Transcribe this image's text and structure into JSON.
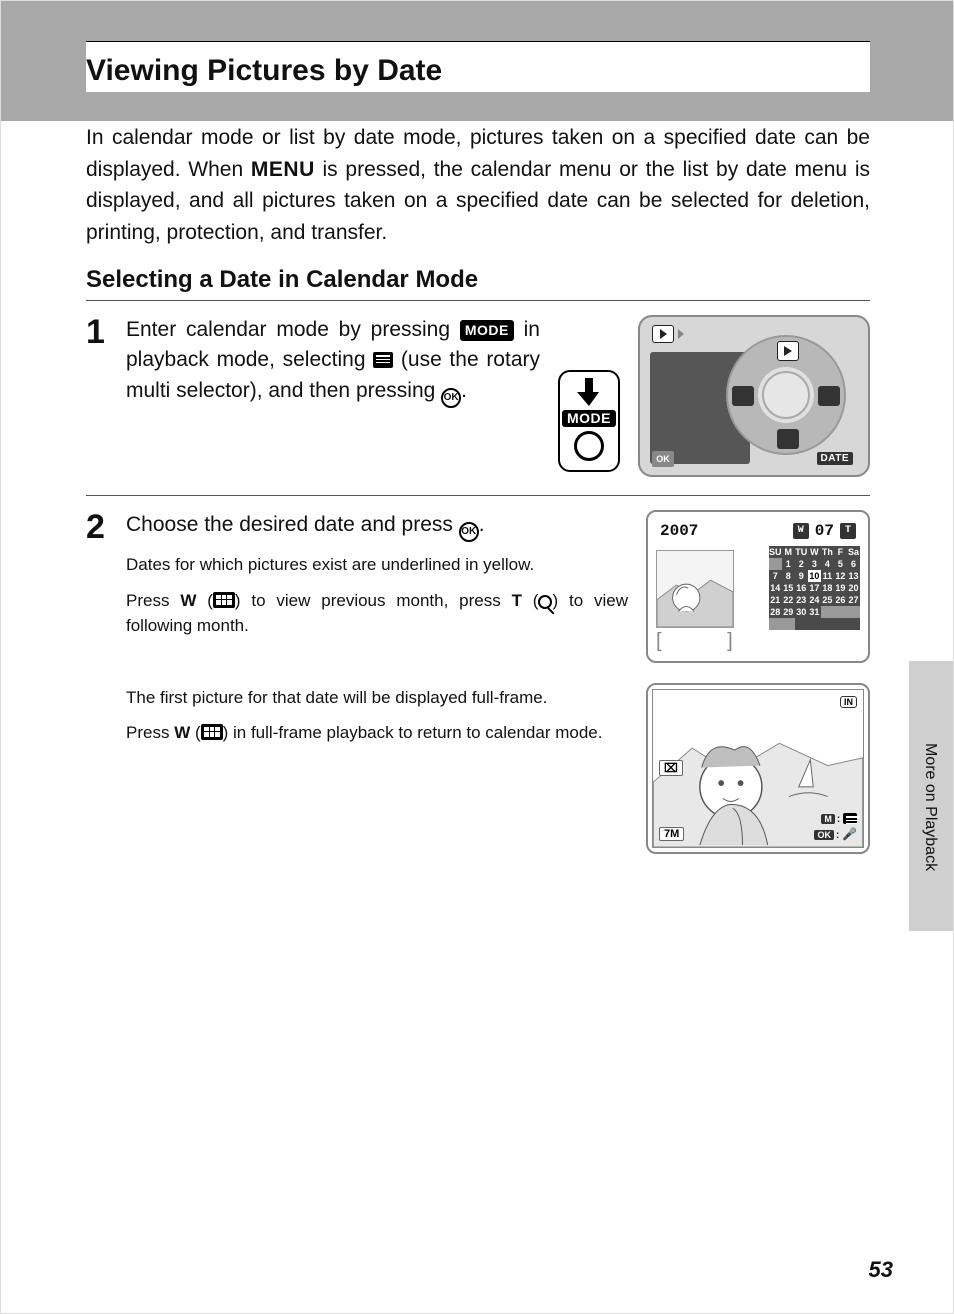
{
  "page_number": "53",
  "side_tab": "More on Playback",
  "title": "Viewing Pictures by Date",
  "intro_1": "In calendar mode or list by date mode, pictures taken on a specified date can be displayed. When ",
  "intro_menu": "MENU",
  "intro_2": " is pressed, the calendar menu or the list by date menu is displayed, and all pictures taken on a specified date can be selected for deletion, printing, protection, and transfer.",
  "h2": "Selecting a Date in Calendar Mode",
  "step1": {
    "num": "1",
    "t1": "Enter calendar mode by pressing ",
    "mode": "MODE",
    "t2": " in playback mode, selecting ",
    "t3": " (use the rotary multi selector), and then pressing ",
    "t4": "."
  },
  "mode_fig_label": "MODE",
  "camera_fig": {
    "ok": "OK",
    "date": "DATE"
  },
  "step2": {
    "num": "2",
    "head1": "Choose the desired date and press ",
    "head2": ".",
    "sub1": "Dates for which pictures exist are underlined in yellow.",
    "sub2a": "Press ",
    "W": "W",
    "sub2b": " (",
    "sub2c": ") to view previous month, press ",
    "T": "T",
    "sub2d": " (",
    "sub2e": ") to view following month.",
    "sub3": "The first picture for that date will be displayed full-frame.",
    "sub4a": "Press ",
    "sub4b": " (",
    "sub4c": ") in full-frame playback to return to calendar mode."
  },
  "calendar": {
    "year": "2007",
    "month": "07",
    "W": "W",
    "T": "T",
    "dow": [
      "SU",
      "M",
      "TU",
      "W",
      "Th",
      "F",
      "Sa"
    ],
    "days": [
      "",
      "1",
      "2",
      "3",
      "4",
      "5",
      "6",
      "7",
      "8",
      "9",
      "10",
      "11",
      "12",
      "13",
      "14",
      "15",
      "16",
      "17",
      "18",
      "19",
      "20",
      "21",
      "22",
      "23",
      "24",
      "25",
      "26",
      "27",
      "28",
      "29",
      "30",
      "31",
      "",
      "",
      "",
      "",
      ""
    ],
    "selected_index": 10
  },
  "full_fig": {
    "in": "IN",
    "M": "M",
    "OK": "OK",
    "size": "7M",
    "cal_badge": "⌧"
  }
}
